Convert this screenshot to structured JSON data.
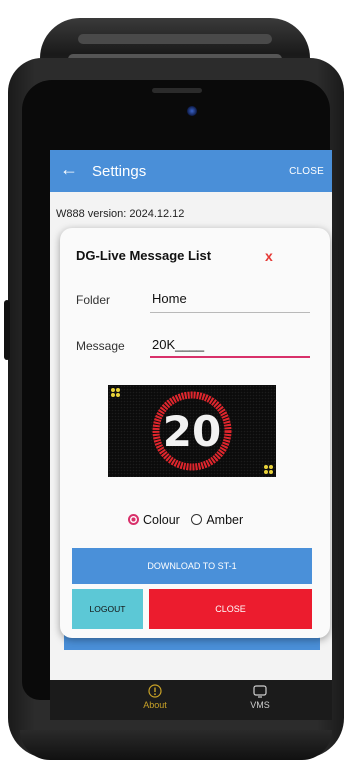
{
  "app_bar": {
    "back_icon": "arrow-left-icon",
    "title": "Settings",
    "close_label": "CLOSE"
  },
  "version_text": "W888   version: 2024.12.12",
  "dialog": {
    "title": "DG-Live Message List",
    "close_x": "x",
    "folder": {
      "label": "Folder",
      "value": "Home"
    },
    "message": {
      "label": "Message",
      "value": "20K____"
    },
    "display": {
      "speed_text": "20",
      "ring_color": "#e0262d",
      "digit_color": "#f2f2f2",
      "corner_color": "#e8d23a"
    },
    "color_mode": {
      "options": [
        "Colour",
        "Amber"
      ],
      "selected": "Colour"
    },
    "download_label": "DOWNLOAD TO ST-1",
    "logout_label": "LOGOUT",
    "close_label": "CLOSE"
  },
  "bottom_nav": [
    {
      "label": "About",
      "icon": "info-circle-icon",
      "active": true
    },
    {
      "label": "VMS",
      "icon": "display-icon",
      "active": false
    }
  ],
  "colors": {
    "accent": "#4a8fd8",
    "danger": "#ec1c2e",
    "logout": "#5cc8d6",
    "radio_active": "#d8306a"
  }
}
